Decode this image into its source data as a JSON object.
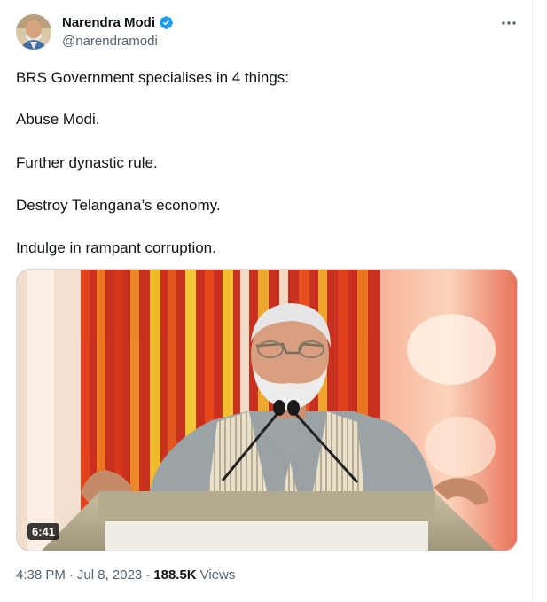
{
  "author": {
    "name": "Narendra Modi",
    "handle": "@narendramodi",
    "verified_color": "#1d9bf0"
  },
  "tweet": {
    "lines": [
      "BRS Government specialises in 4 things:",
      "Abuse Modi.",
      "Further dynastic rule.",
      "Destroy Telangana’s economy.",
      "Indulge in rampant corruption."
    ]
  },
  "video": {
    "duration": "6:41"
  },
  "meta": {
    "time": "4:38 PM",
    "separator": "·",
    "date": "Jul 8, 2023",
    "views_count": "188.5K",
    "views_label": "Views"
  },
  "icons": {
    "more": "more-horizontal-icon",
    "verified": "verified-badge-icon"
  }
}
